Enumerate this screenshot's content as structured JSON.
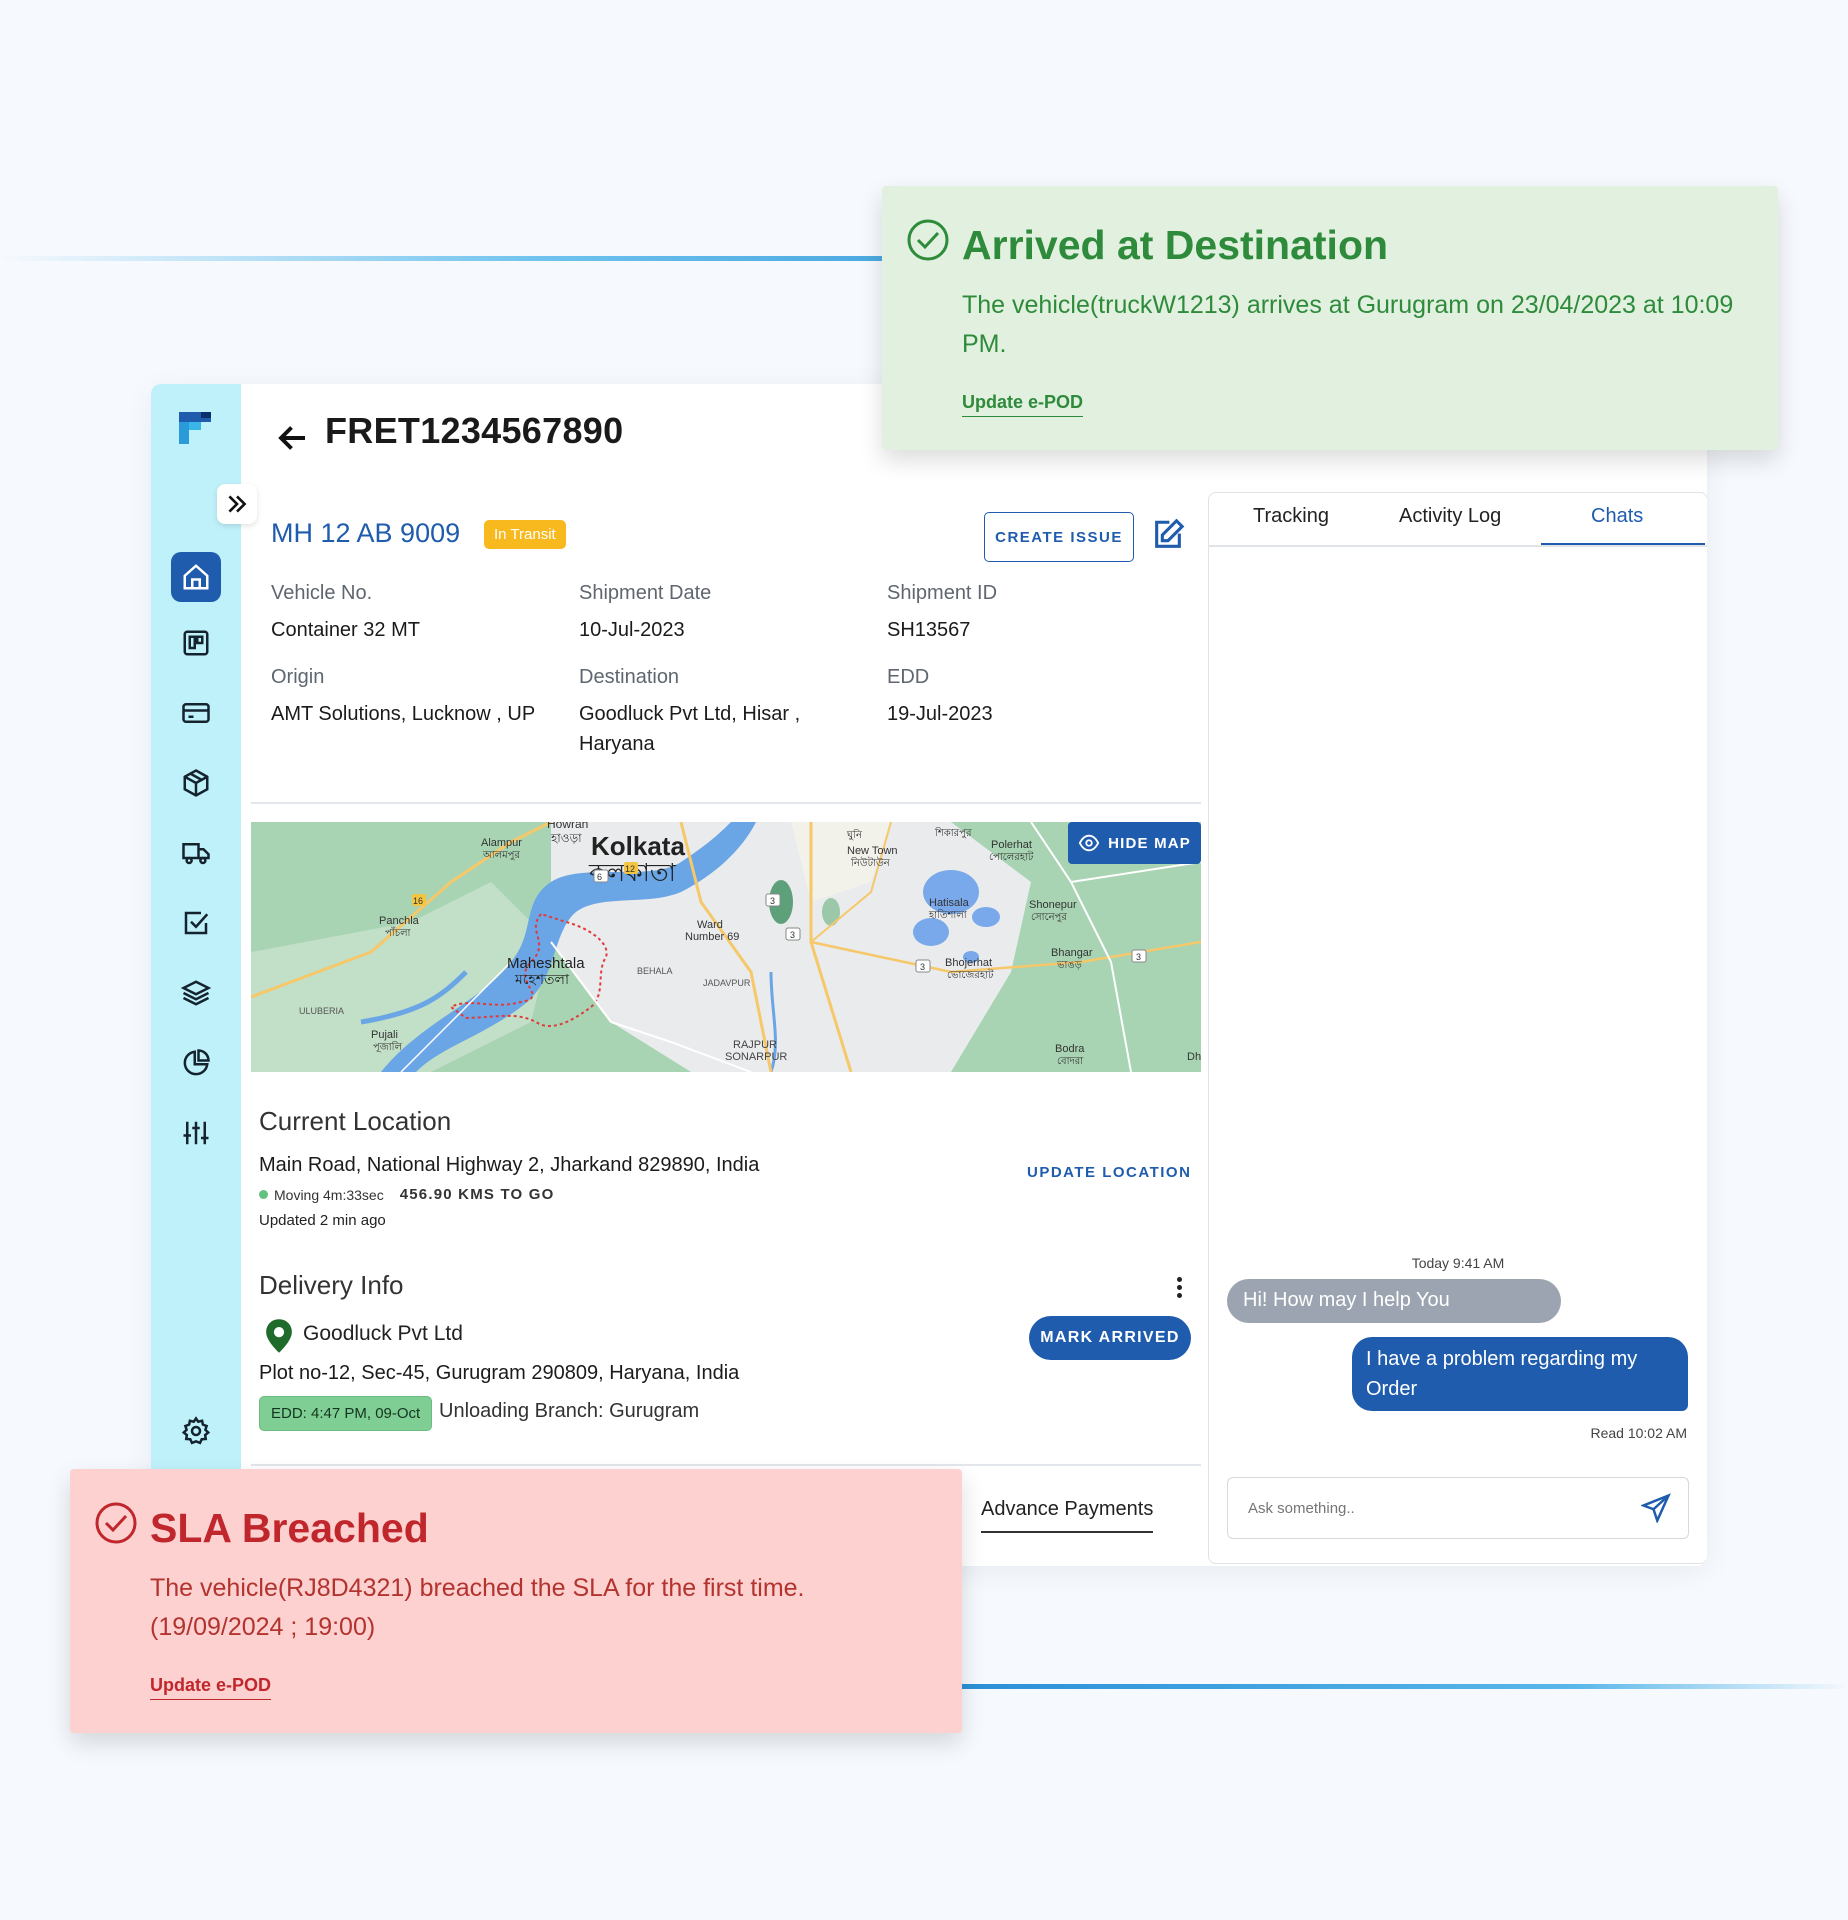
{
  "header": {
    "title": "FRET1234567890"
  },
  "shipment": {
    "vehicle_number": "MH 12 AB 9009",
    "status_badge": "In Transit",
    "create_issue_label": "CREATE ISSUE",
    "fields": {
      "vehicle_label": "Vehicle No.",
      "vehicle_value": "Container 32 MT",
      "date_label": "Shipment Date",
      "date_value": "10-Jul-2023",
      "id_label": "Shipment ID",
      "id_value": "SH13567",
      "origin_label": "Origin",
      "origin_value": "AMT Solutions, Lucknow , UP",
      "destination_label": "Destination",
      "destination_value": "Goodluck Pvt Ltd, Hisar , Haryana",
      "edd_label": "EDD",
      "edd_value": "19-Jul-2023"
    }
  },
  "map": {
    "hide_label": "HIDE MAP",
    "labels": {
      "kolkata": "Kolkata",
      "kolkata_bn": "কলকাতা",
      "howrah": "Howrah",
      "howrah_bn": "হাওড়া",
      "maheshtala": "Maheshtala",
      "maheshtala_bn": "মহেশতলা",
      "alampur": "Alampur",
      "alampur_bn": "আলমপুর",
      "panchla": "Panchla",
      "panchla_bn": "পাঁচলা",
      "ward": "Ward",
      "number69": "Number 69",
      "new_town": "New Town",
      "new_town_bn": "নিউটাউন",
      "polerhat": "Polerhat",
      "polerhat_bn": "পোলেরহাট",
      "hatisala": "Hatisala",
      "hatisala_bn": "হাতিশালা",
      "shonepur": "Shonepur",
      "shonepur_bn": "সোনেপুর",
      "bhojerhat": "Bhojerhat",
      "bhojerhat_bn": "ভোজেরহাট",
      "bhangar": "Bhangar",
      "bhangar_bn": "ভাঙড়",
      "behala": "BEHALA",
      "jadavpur": "JADAVPUR",
      "rajpur": "RAJPUR",
      "sonarpur": "SONARPUR",
      "uluberia": "ULUBERIA",
      "pujali": "Pujali",
      "pujali_bn": "পূজালি",
      "bodra": "Bodra",
      "bodra_bn": "বোদরা",
      "shikarpur_bn": "শিকারপুর",
      "ghuni_bn": "ঘুনি",
      "dh": "Dh",
      "road_3a": "3",
      "road_3b": "3",
      "road_3c": "3",
      "road_3d": "3",
      "road_6": "6",
      "road_12": "12",
      "road_16": "16"
    }
  },
  "current_location": {
    "title": "Current Location",
    "address": "Main Road, National Highway 2, Jharkand 829890, India",
    "moving": "Moving 4m:33sec",
    "distance": "456.90 KMS TO GO",
    "updated": "Updated 2 min ago",
    "update_label": "UPDATE LOCATION"
  },
  "delivery": {
    "title": "Delivery Info",
    "company": "Goodluck Pvt Ltd",
    "mark_arrived_label": "MARK ARRIVED",
    "address": "Plot no-12, Sec-45, Gurugram 290809, Haryana, India",
    "edd_chip": "EDD: 4:47 PM, 09-Oct",
    "unloading": "Unloading Branch: Gurugram"
  },
  "bottom_tabs": {
    "advance_payments": "Advance Payments"
  },
  "right_panel": {
    "tabs": [
      "Tracking",
      "Activity Log",
      "Chats"
    ],
    "active_tab": "Chats",
    "chat_time": "Today 9:41 AM",
    "incoming": "Hi! How may I help You",
    "outgoing": "I have a problem regarding my Order",
    "read_time": "Read 10:02 AM",
    "input_placeholder": "Ask something.."
  },
  "toast_arrived": {
    "title": "Arrived at Destination",
    "body": "The vehicle(truckW1213)  arrives at Gurugram on 23/04/2023 at 10:09 PM.",
    "link": "Update e-POD"
  },
  "toast_sla": {
    "title": "SLA Breached",
    "body": "The vehicle(RJ8D4321) breached the SLA for the first time. (19/09/2024 ; 19:00)",
    "link": "Update e-POD"
  },
  "colors": {
    "primary": "#1f5cae",
    "sidebar": "#bff1fb",
    "transit": "#f7b91e",
    "success": "#2e8b3b",
    "danger": "#c0272d"
  },
  "icons": [
    "home-icon",
    "board-icon",
    "card-icon",
    "package-icon",
    "truck-icon",
    "checkbox-icon",
    "layers-icon",
    "pie-chart-icon",
    "sliders-icon",
    "gear-icon"
  ]
}
